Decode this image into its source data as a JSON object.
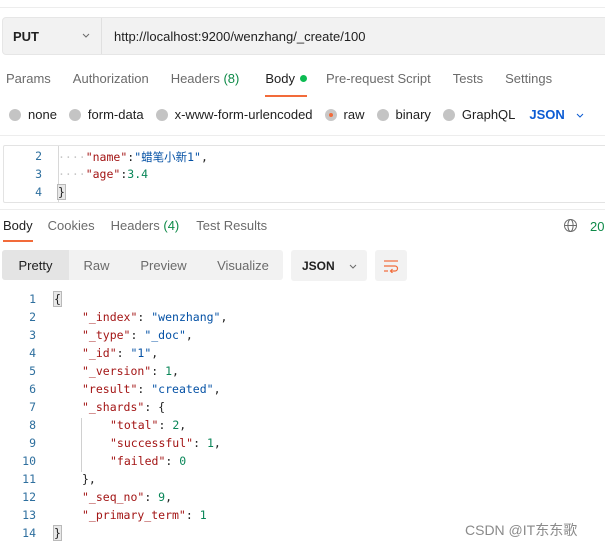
{
  "request": {
    "method": "PUT",
    "url": "http://localhost:9200/wenzhang/_create/100",
    "tabs": [
      {
        "label": "Params"
      },
      {
        "label": "Authorization"
      },
      {
        "label": "Headers",
        "count": "(8)"
      },
      {
        "label": "Body",
        "active": true,
        "indicator": "green-dot"
      },
      {
        "label": "Pre-request Script"
      },
      {
        "label": "Tests"
      },
      {
        "label": "Settings"
      }
    ],
    "body_types": [
      {
        "label": "none"
      },
      {
        "label": "form-data"
      },
      {
        "label": "x-www-form-urlencoded"
      },
      {
        "label": "raw",
        "checked": true
      },
      {
        "label": "binary"
      },
      {
        "label": "GraphQL"
      }
    ],
    "body_format": "JSON",
    "editor_lines": [
      {
        "num": "2",
        "indent": "····",
        "key": "\"name\"",
        "colon": ":",
        "value": "\"蜡笔小新1\"",
        "value_type": "string",
        "trail": ","
      },
      {
        "num": "3",
        "indent": "····",
        "key": "\"age\"",
        "colon": ":",
        "value": "3.4",
        "value_type": "number",
        "trail": ""
      },
      {
        "num": "4",
        "brace": "}"
      }
    ]
  },
  "response": {
    "tabs": [
      {
        "label": "Body",
        "active": true
      },
      {
        "label": "Cookies"
      },
      {
        "label": "Headers",
        "count": "(4)"
      },
      {
        "label": "Test Results"
      }
    ],
    "status_partial": "20",
    "view_modes": [
      {
        "label": "Pretty",
        "active": true
      },
      {
        "label": "Raw"
      },
      {
        "label": "Preview"
      },
      {
        "label": "Visualize"
      }
    ],
    "format": "JSON",
    "lines": [
      {
        "num": "1",
        "indent": 0,
        "parts": [
          [
            "p",
            "{"
          ]
        ],
        "brace_hl": true
      },
      {
        "num": "2",
        "indent": 1,
        "parts": [
          [
            "k",
            "\"_index\""
          ],
          [
            "p",
            ": "
          ],
          [
            "s",
            "\"wenzhang\""
          ],
          [
            "p",
            ","
          ]
        ]
      },
      {
        "num": "3",
        "indent": 1,
        "parts": [
          [
            "k",
            "\"_type\""
          ],
          [
            "p",
            ": "
          ],
          [
            "s",
            "\"_doc\""
          ],
          [
            "p",
            ","
          ]
        ]
      },
      {
        "num": "4",
        "indent": 1,
        "parts": [
          [
            "k",
            "\"_id\""
          ],
          [
            "p",
            ": "
          ],
          [
            "s",
            "\"1\""
          ],
          [
            "p",
            ","
          ]
        ]
      },
      {
        "num": "5",
        "indent": 1,
        "parts": [
          [
            "k",
            "\"_version\""
          ],
          [
            "p",
            ": "
          ],
          [
            "n",
            "1"
          ],
          [
            "p",
            ","
          ]
        ]
      },
      {
        "num": "6",
        "indent": 1,
        "parts": [
          [
            "k",
            "\"result\""
          ],
          [
            "p",
            ": "
          ],
          [
            "s",
            "\"created\""
          ],
          [
            "p",
            ","
          ]
        ]
      },
      {
        "num": "7",
        "indent": 1,
        "parts": [
          [
            "k",
            "\"_shards\""
          ],
          [
            "p",
            ": {"
          ]
        ]
      },
      {
        "num": "8",
        "indent": 2,
        "parts": [
          [
            "k",
            "\"total\""
          ],
          [
            "p",
            ": "
          ],
          [
            "n",
            "2"
          ],
          [
            "p",
            ","
          ]
        ]
      },
      {
        "num": "9",
        "indent": 2,
        "parts": [
          [
            "k",
            "\"successful\""
          ],
          [
            "p",
            ": "
          ],
          [
            "n",
            "1"
          ],
          [
            "p",
            ","
          ]
        ]
      },
      {
        "num": "10",
        "indent": 2,
        "parts": [
          [
            "k",
            "\"failed\""
          ],
          [
            "p",
            ": "
          ],
          [
            "n",
            "0"
          ]
        ]
      },
      {
        "num": "11",
        "indent": 1,
        "parts": [
          [
            "p",
            "},"
          ]
        ]
      },
      {
        "num": "12",
        "indent": 1,
        "parts": [
          [
            "k",
            "\"_seq_no\""
          ],
          [
            "p",
            ": "
          ],
          [
            "n",
            "9"
          ],
          [
            "p",
            ","
          ]
        ]
      },
      {
        "num": "13",
        "indent": 1,
        "parts": [
          [
            "k",
            "\"_primary_term\""
          ],
          [
            "p",
            ": "
          ],
          [
            "n",
            "1"
          ]
        ]
      },
      {
        "num": "14",
        "indent": 0,
        "parts": [
          [
            "p",
            "}"
          ]
        ],
        "brace_hl": true
      }
    ]
  },
  "watermark": "CSDN @IT东东歌",
  "icons": {
    "method_dropdown": "chevron-down-icon",
    "format_dropdown": "chevron-down-icon",
    "globe": "globe-icon",
    "wrap": "wrap-lines-icon"
  },
  "colors": {
    "accent": "#f26b3a",
    "active_dot": "#0cbb52",
    "count_green": "#0e8a48",
    "json_link": "#0b5bd3",
    "key": "#a31515",
    "string": "#0451a5",
    "number": "#098658",
    "line_number": "#2e6f9e"
  }
}
